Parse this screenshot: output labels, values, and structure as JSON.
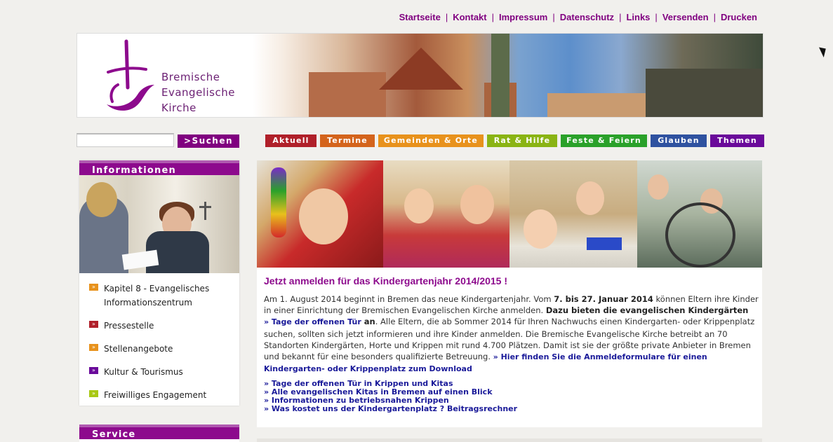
{
  "top_links": [
    "Startseite",
    "Kontakt",
    "Impressum",
    "Datenschutz",
    "Links",
    "Versenden",
    "Drucken"
  ],
  "logo": {
    "line1": "Bremische",
    "line2": "Evangelische",
    "line3": "Kirche",
    "color": "#6b1f73"
  },
  "search": {
    "value": "",
    "button_label": ">Suchen"
  },
  "nav": [
    {
      "label": "Aktuell",
      "color": "#b0202a"
    },
    {
      "label": "Termine",
      "color": "#d4641c"
    },
    {
      "label": "Gemeinden & Orte",
      "color": "#e8921c"
    },
    {
      "label": "Rat & Hilfe",
      "color": "#8ab414"
    },
    {
      "label": "Feste & Feiern",
      "color": "#2aa12a"
    },
    {
      "label": "Glauben",
      "color": "#2f52a0"
    },
    {
      "label": "Themen",
      "color": "#6a0a9a"
    }
  ],
  "sidebar": {
    "heading": "Informationen",
    "items": [
      {
        "label": "Kapitel 8 - Evangelisches Informationszentrum",
        "bullet_color": "#e8921c"
      },
      {
        "label": "Pressestelle",
        "bullet_color": "#b0202a"
      },
      {
        "label": "Stellenangebote",
        "bullet_color": "#e8921c"
      },
      {
        "label": "Kultur & Tourismus",
        "bullet_color": "#6a0a9a"
      },
      {
        "label": "Freiwilliges Engagement",
        "bullet_color": "#a8c814"
      }
    ],
    "service_heading": "Service"
  },
  "main": {
    "title": "Jetzt anmelden für das Kindergartenjahr 2014/2015 !",
    "p1": "Am 1. August 2014 beginnt in Bremen das neue Kindergartenjahr. Vom ",
    "p1_bold": "7. bis 27. Januar 2014",
    "p2": " können Eltern ihre Kinder in einer Einrichtung der Bremischen Evangelischen Kirche anmelden. ",
    "p2_bold": "Dazu bieten die evangelischen Kindergärten",
    "link1": "» Tage der offenen Tür",
    "link1_suffix": " an",
    "p3": ". Alle Eltern, die ab Sommer 2014 für Ihren Nachwuchs einen Kindergarten- oder Krippenplatz suchen, sollten sich jetzt informieren und ihre Kinder anmelden. Die Bremische Evangelische Kirche betreibt an 70 Standorten Kindergärten, Horte und Krippen mit rund 4.700 Plätzen. Damit ist sie der größte private Anbieter in Bremen und bekannt für eine besonders qualifizierte Betreuung. ",
    "link2": "» Hier finden Sie die Anmeldeformulare für einen Kindergarten- oder Krippenplatz zum Download",
    "links": [
      "» Tage der offenen Tür in Krippen und Kitas",
      "» Alle evangelischen Kitas in Bremen auf einen Blick",
      "» Informationen zu betriebsnahen Krippen",
      "» Was kostet uns der Kindergartenplatz ? Beitragsrechner"
    ]
  }
}
